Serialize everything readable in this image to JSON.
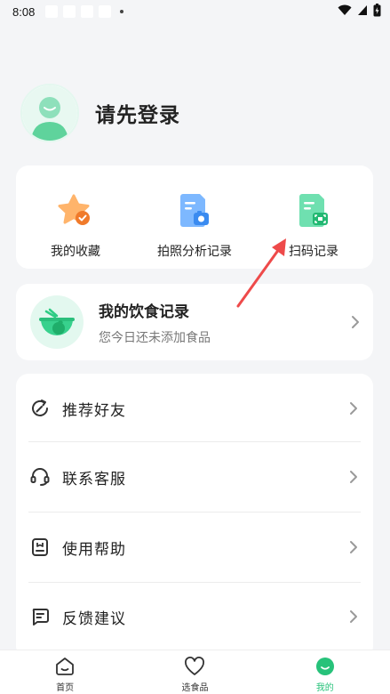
{
  "status_bar": {
    "time": "8:08"
  },
  "profile": {
    "login_prompt": "请先登录"
  },
  "quick_actions": [
    {
      "label": "我的收藏",
      "icon": "star-check-icon"
    },
    {
      "label": "拍照分析记录",
      "icon": "photo-document-icon"
    },
    {
      "label": "扫码记录",
      "icon": "scan-document-icon"
    }
  ],
  "diet_record": {
    "title": "我的饮食记录",
    "subtitle": "您今日还未添加食品",
    "icon": "food-bowl-icon"
  },
  "menu": [
    {
      "label": "推荐好友",
      "icon": "share-icon"
    },
    {
      "label": "联系客服",
      "icon": "headset-icon"
    },
    {
      "label": "使用帮助",
      "icon": "help-book-icon"
    },
    {
      "label": "反馈建议",
      "icon": "feedback-icon"
    }
  ],
  "tabbar": {
    "items": [
      {
        "label": "首页",
        "icon": "home-icon"
      },
      {
        "label": "选食品",
        "icon": "heart-icon"
      },
      {
        "label": "我的",
        "icon": "profile-smile-icon"
      }
    ],
    "active": "我的"
  },
  "colors": {
    "accent": "#27c27a",
    "background": "#f4f5f7",
    "annotation_arrow": "#ee4a4a"
  }
}
